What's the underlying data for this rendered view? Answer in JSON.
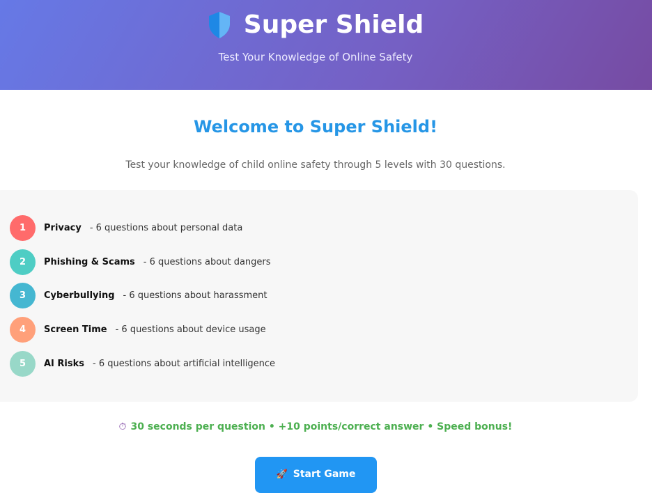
{
  "header": {
    "title": "Super Shield",
    "subtitle": "Test Your Knowledge of Online Safety",
    "logo_icon": "shield-icon"
  },
  "welcome": {
    "title": "Welcome to Super Shield!",
    "intro": "Test your knowledge of child online safety through 5 levels with 30 questions."
  },
  "levels": [
    {
      "number": "1",
      "name": "Privacy",
      "desc": "- 6 questions about personal data",
      "color": "#ff6b6b"
    },
    {
      "number": "2",
      "name": "Phishing & Scams",
      "desc": "- 6 questions about dangers",
      "color": "#4ecdc4"
    },
    {
      "number": "3",
      "name": "Cyberbullying",
      "desc": "- 6 questions about harassment",
      "color": "#45b7d1"
    },
    {
      "number": "4",
      "name": "Screen Time",
      "desc": "- 6 questions about device usage",
      "color": "#ffa07a"
    },
    {
      "number": "5",
      "name": "AI Risks",
      "desc": "- 6 questions about artificial intelligence",
      "color": "#98d8c8"
    }
  ],
  "rules": {
    "icon": "stopwatch-icon",
    "text": "30 seconds per question • +10 points/correct answer • Speed bonus!"
  },
  "start_button": {
    "label": "Start Game",
    "icon": "rocket-icon"
  },
  "colors": {
    "header_start": "#6679e6",
    "header_end": "#764ba2",
    "accent": "#2696e6",
    "rules": "#4caf50",
    "button": "#2196f3"
  }
}
